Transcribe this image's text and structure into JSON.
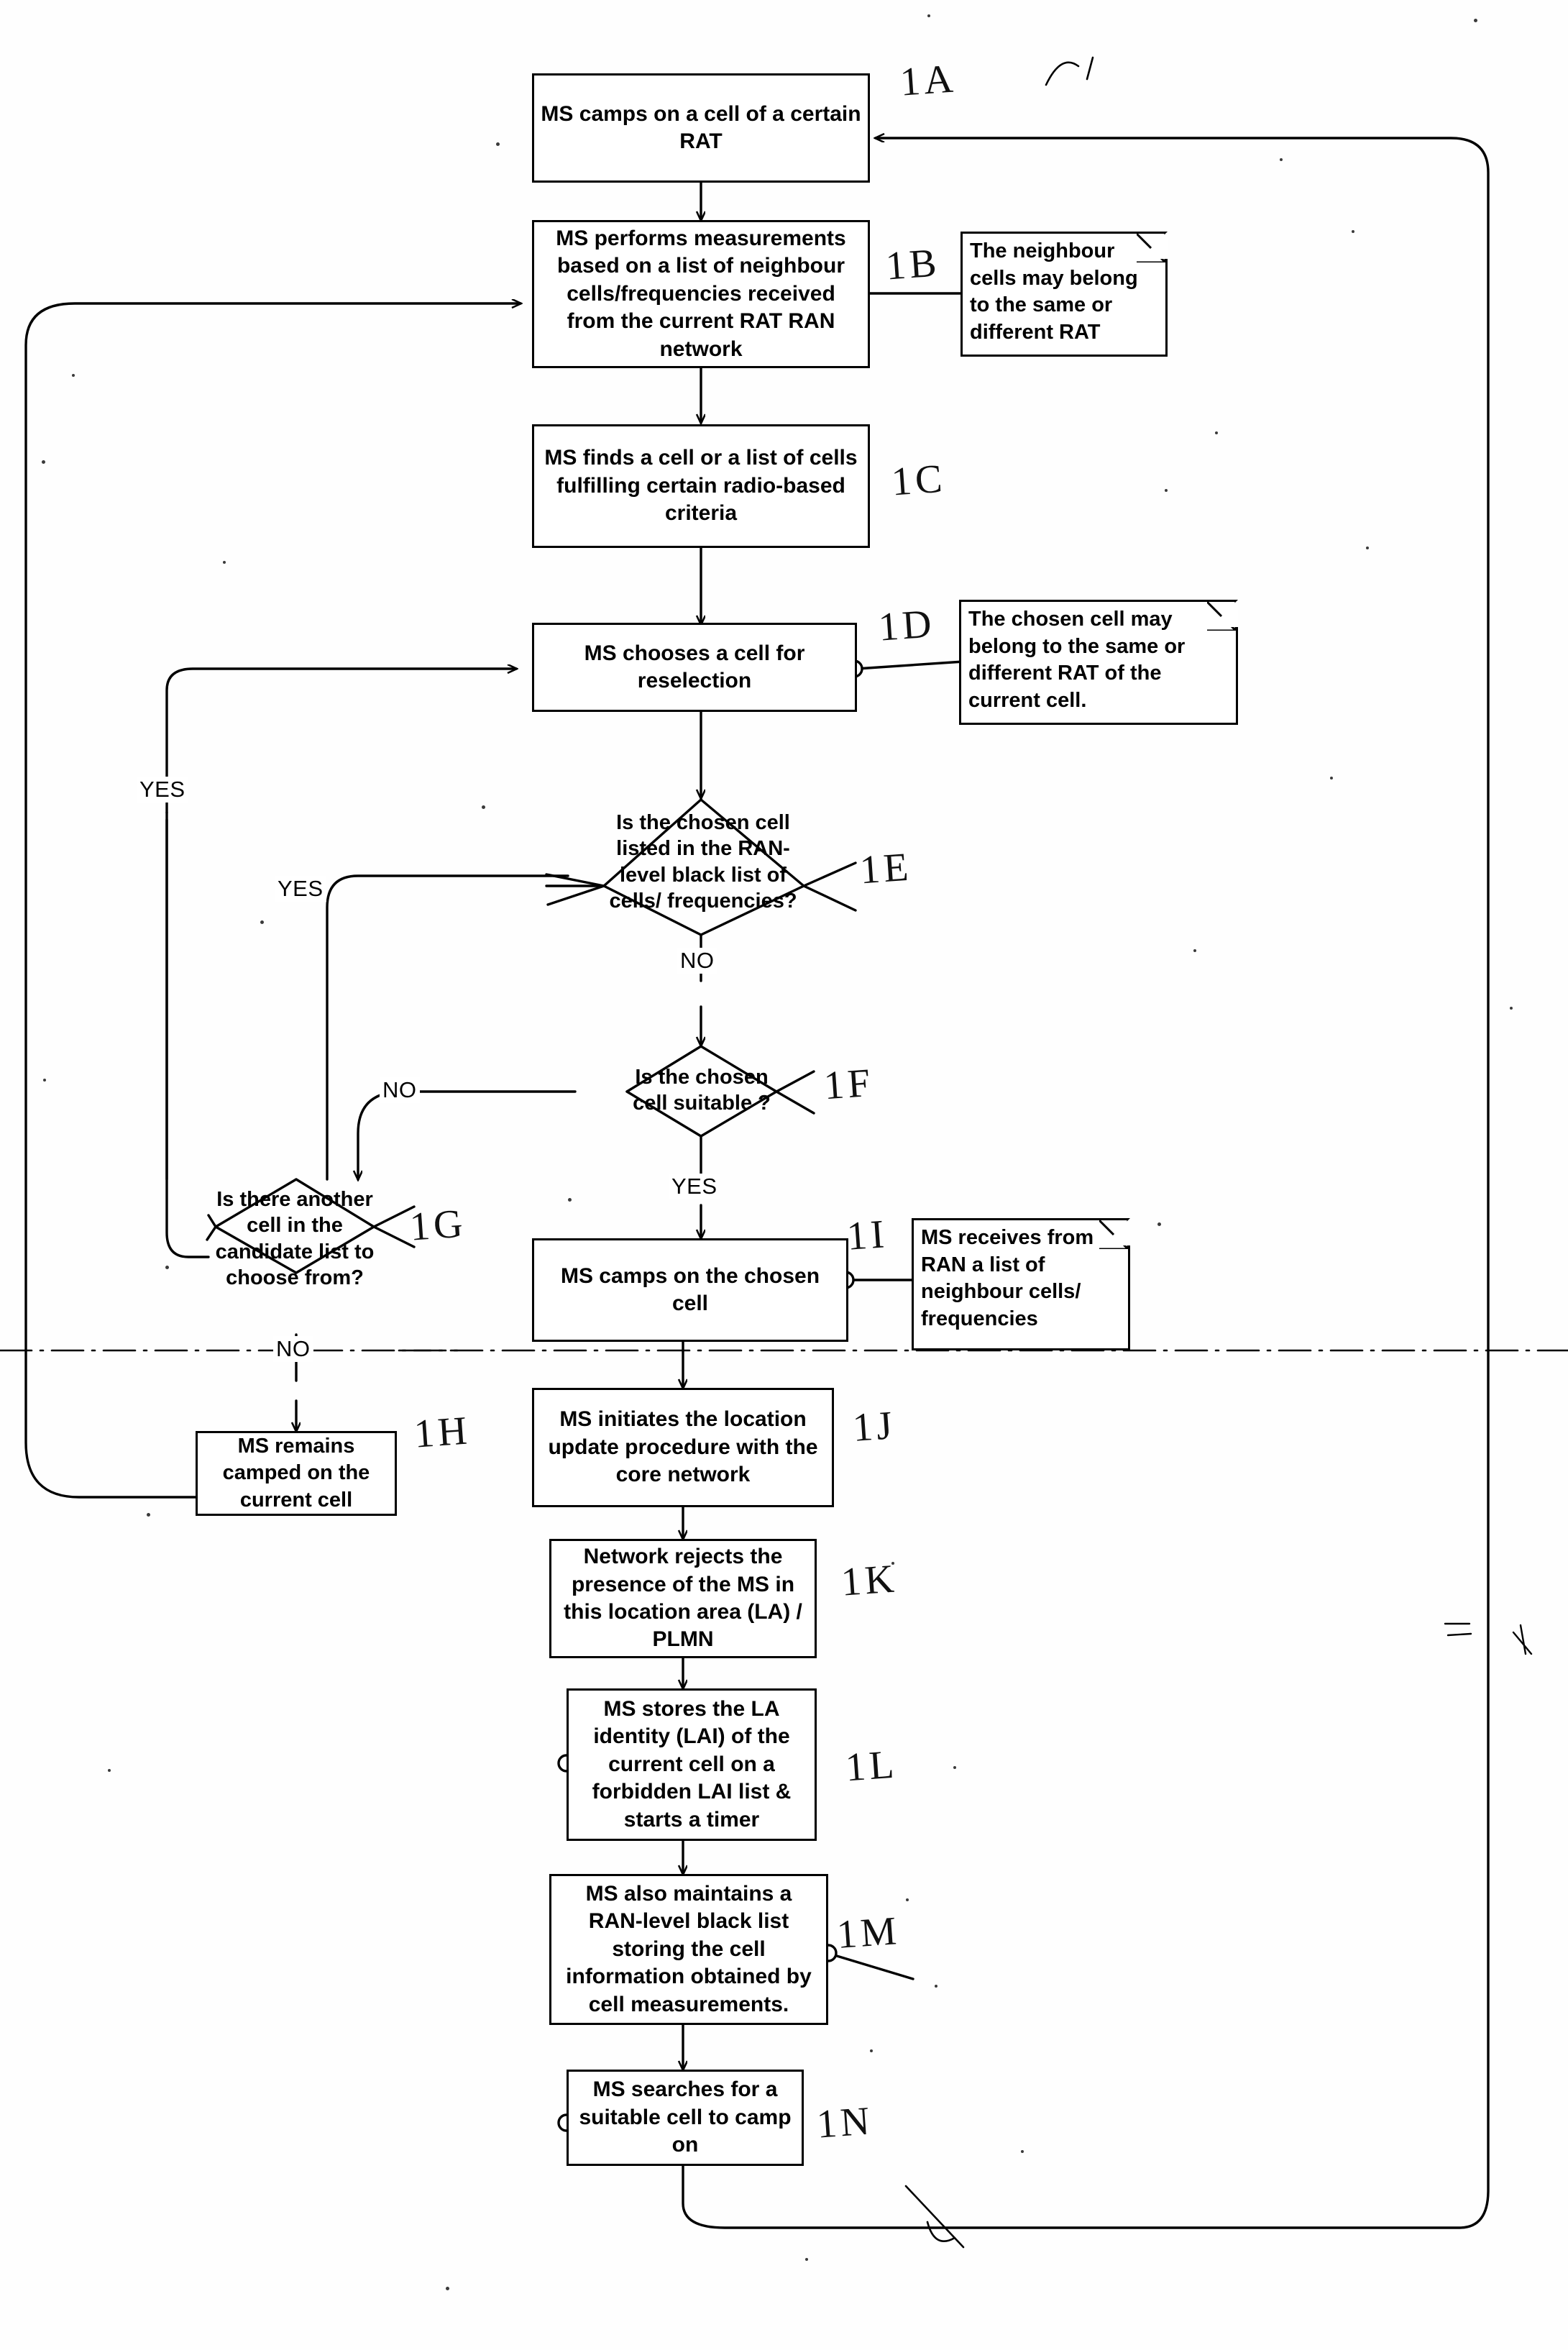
{
  "figure": {
    "type": "flowchart",
    "subject": "MS cell reselection and RAN-level black list procedure"
  },
  "nodes": [
    {
      "id": "1A",
      "tag": "1A",
      "text": "MS camps on a cell of a certain RAT"
    },
    {
      "id": "1B",
      "tag": "1B",
      "text": "MS performs measurements based on a list of neighbour cells/frequencies received from the current RAT RAN network"
    },
    {
      "id": "1C",
      "tag": "1C",
      "text": "MS finds a cell or a list of cells fulfilling certain radio-based criteria"
    },
    {
      "id": "1D",
      "tag": "1D",
      "text": "MS chooses a cell for reselection"
    },
    {
      "id": "1E",
      "tag": "1E",
      "text": "Is the chosen cell listed in the RAN-level black list of cells/ frequencies?"
    },
    {
      "id": "1F",
      "tag": "1F",
      "text": "Is the chosen cell suitable ?"
    },
    {
      "id": "1G",
      "tag": "1G",
      "text": "Is there another cell in the candidate list to choose from?"
    },
    {
      "id": "1H",
      "tag": "1H",
      "text": "MS remains camped on the current cell"
    },
    {
      "id": "1I",
      "tag": "1I",
      "text": "MS camps  on the chosen cell"
    },
    {
      "id": "1J",
      "tag": "1J",
      "text": "MS initiates  the location update procedure with the core network"
    },
    {
      "id": "1K",
      "tag": "1K",
      "text": "Network  rejects the presence of the MS in this location area (LA) / PLMN"
    },
    {
      "id": "1L",
      "tag": "1L",
      "text": "MS stores the LA identity  (LAI) of the current cell on a forbidden LAI list  & starts a timer"
    },
    {
      "id": "1M",
      "tag": "1M",
      "text": "MS also maintains a RAN-level black list storing the cell information obtained by cell measurements."
    },
    {
      "id": "1N",
      "tag": "1N",
      "text": "MS searches for a suitable cell to camp on"
    }
  ],
  "notes": [
    {
      "id": "note-1B",
      "text": "The neighbour cells may belong to the same or different RAT"
    },
    {
      "id": "note-1D",
      "text": "The chosen cell may belong to the same or different RAT of the current cell."
    },
    {
      "id": "note-1I",
      "text": "MS receives from RAN a list of neighbour cells/ frequencies"
    }
  ],
  "branch_labels": {
    "yes_1e_outer": "YES",
    "yes_1e": "YES",
    "no_1e": "NO",
    "no_1f": "NO",
    "yes_1f": "YES",
    "no_1g": "NO"
  },
  "tags": {
    "t1A": "1A",
    "t1B": "1B",
    "t1C": "1C",
    "t1D": "1D",
    "t1E": "1E",
    "t1F": "1F",
    "t1G": "1G",
    "t1H": "1H",
    "t1I": "1I",
    "t1J": "1J",
    "t1K": "1K",
    "t1L": "1L",
    "t1M": "1M",
    "t1N": "1N"
  },
  "colors": {
    "ink": "#000000",
    "paper": "#ffffff"
  }
}
